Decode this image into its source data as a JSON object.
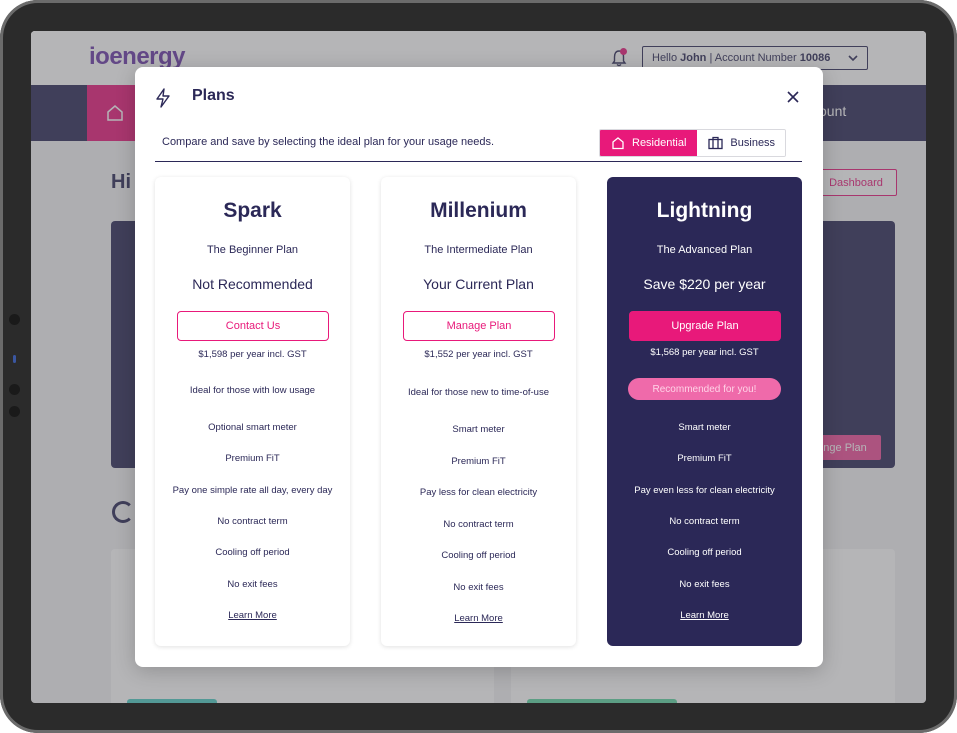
{
  "app": {
    "logo": "ioenergy",
    "greeting_prefix": "Hello ",
    "user_name": "John",
    "account_label": " | Account Number ",
    "account_number": "10086",
    "nav_account": "ount",
    "page_heading": "Hi",
    "dashboard_button": "Dashboard",
    "manage_plan_button": "nge Plan"
  },
  "modal": {
    "title": "Plans",
    "subtitle": "Compare and save by selecting the ideal plan for your usage needs.",
    "toggle": {
      "residential": "Residential",
      "business": "Business",
      "selected": "Residential"
    }
  },
  "plans": [
    {
      "name": "Spark",
      "tier": "The Beginner Plan",
      "status": "Not Recommended",
      "button": "Contact Us",
      "price": "$1,598 per year incl. GST",
      "badge": "",
      "features": [
        "Ideal for those with low usage",
        "Optional smart meter",
        "Premium FiT",
        "Pay one simple rate all day, every day",
        "No contract term",
        "Cooling off period",
        "No exit fees"
      ],
      "learn_more": "Learn More"
    },
    {
      "name": "Millenium",
      "tier": "The Intermediate Plan",
      "status": "Your Current Plan",
      "button": "Manage Plan",
      "price": "$1,552 per year incl. GST",
      "badge": "",
      "features": [
        "Ideal for those new to time-of-use",
        "Smart meter",
        "Premium FiT",
        "Pay less for clean electricity",
        "No contract term",
        "Cooling off period",
        "No exit fees"
      ],
      "learn_more": "Learn More"
    },
    {
      "name": "Lightning",
      "tier": "The Advanced Plan",
      "status": "Save $220 per year",
      "button": "Upgrade Plan",
      "price": "$1,568 per year incl. GST",
      "badge": "Recommended for you!",
      "features": [
        "Smart meter",
        "Premium FiT",
        "Pay even less for clean electricity",
        "No contract term",
        "Cooling off period",
        "No exit fees"
      ],
      "learn_more": "Learn More"
    }
  ],
  "colors": {
    "accent": "#e8197a",
    "navy": "#2b2857",
    "brand": "#6b3aa8"
  },
  "icons": [
    "bell-icon",
    "chevron-down-icon",
    "home-icon",
    "lightning-icon",
    "close-icon",
    "building-icon"
  ]
}
